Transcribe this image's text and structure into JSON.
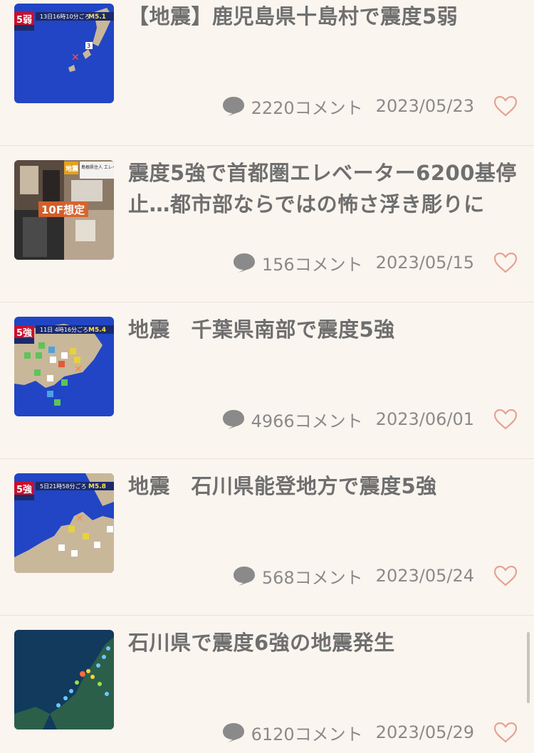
{
  "colors": {
    "background": "#fbf5ef",
    "title_text": "#6f6f6f",
    "meta_text": "#8a8a8a",
    "heart_outline": "#e3a394",
    "comment_icon": "#8a8a8a"
  },
  "articles": [
    {
      "title": "【地震】鹿児島県十島村で震度5弱",
      "comments": "2220コメント",
      "date": "2023/05/23",
      "thumb": {
        "badge": "5弱",
        "time": "13日16時10分ごろ",
        "magnitude": "M5.1"
      }
    },
    {
      "title": "震度5強で首都圏エレベーター6200基停止…都市部ならではの怖さ浮き彫りに",
      "comments": "156コメント",
      "date": "2023/05/15",
      "thumb": {
        "caption": "10F想定",
        "tag": "地震",
        "subcaption": "島根県住人 エレベーター"
      }
    },
    {
      "title": "地震　千葉県南部で震度5強",
      "comments": "4966コメント",
      "date": "2023/06/01",
      "thumb": {
        "badge": "5強",
        "time": "11日 4時16分ごろ",
        "magnitude": "M5.4"
      }
    },
    {
      "title": "地震　石川県能登地方で震度5強",
      "comments": "568コメント",
      "date": "2023/05/24",
      "thumb": {
        "badge": "5強",
        "time": "5日21時58分ごろ",
        "magnitude": "M5.8"
      }
    },
    {
      "title": "石川県で震度6強の地震発生",
      "comments": "6120コメント",
      "date": "2023/05/29",
      "thumb": {}
    }
  ]
}
